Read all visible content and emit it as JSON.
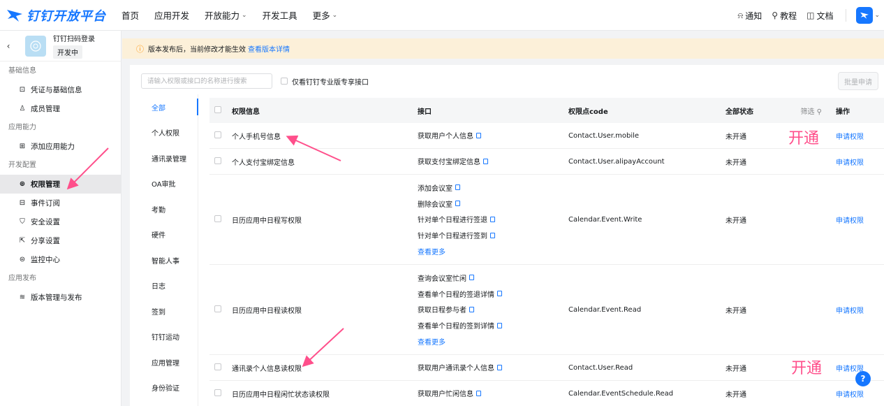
{
  "topbar": {
    "logo_text": "钉钉开放平台",
    "nav": [
      {
        "label": "首页",
        "dropdown": false
      },
      {
        "label": "应用开发",
        "dropdown": false
      },
      {
        "label": "开放能力",
        "dropdown": true
      },
      {
        "label": "开发工具",
        "dropdown": false
      },
      {
        "label": "更多",
        "dropdown": true
      }
    ],
    "notify": "通知",
    "tutorial": "教程",
    "docs": "文档"
  },
  "sidebar": {
    "app_name": "钉钉扫码登录",
    "app_status": "开发中",
    "groups": [
      {
        "label": "基础信息",
        "items": [
          {
            "label": "凭证与基础信息",
            "icon": "credential-icon",
            "glyph": "⊡"
          },
          {
            "label": "成员管理",
            "icon": "member-icon",
            "glyph": "♙"
          }
        ]
      },
      {
        "label": "应用能力",
        "items": [
          {
            "label": "添加应用能力",
            "icon": "add-capability-icon",
            "glyph": "⊞"
          }
        ]
      },
      {
        "label": "开发配置",
        "items": [
          {
            "label": "权限管理",
            "icon": "permission-icon",
            "glyph": "⊕",
            "active": true
          },
          {
            "label": "事件订阅",
            "icon": "event-icon",
            "glyph": "⊟"
          },
          {
            "label": "安全设置",
            "icon": "shield-icon",
            "glyph": "⛉"
          },
          {
            "label": "分享设置",
            "icon": "share-icon",
            "glyph": "⇱"
          },
          {
            "label": "监控中心",
            "icon": "monitor-icon",
            "glyph": "⊜"
          }
        ]
      },
      {
        "label": "应用发布",
        "items": [
          {
            "label": "版本管理与发布",
            "icon": "layers-icon",
            "glyph": "≋"
          }
        ]
      }
    ]
  },
  "notice": {
    "text": "版本发布后，当前修改才能生效",
    "link": "查看版本详情"
  },
  "filter": {
    "search_placeholder": "请输入权限或接口的名称进行搜索",
    "only_pro": "仅看钉钉专业版专享接口",
    "batch_apply": "批量申请"
  },
  "categories": [
    "全部",
    "个人权限",
    "通讯录管理",
    "OA审批",
    "考勤",
    "硬件",
    "智能人事",
    "日志",
    "签到",
    "钉钉运动",
    "应用管理",
    "身份验证"
  ],
  "table": {
    "headers": {
      "perm": "权限信息",
      "api": "接口",
      "code": "权限点code",
      "status": "全部状态",
      "filter": "筛选",
      "op": "操作"
    },
    "rows": [
      {
        "perm": "个人手机号信息",
        "apis": [
          "获取用户个人信息"
        ],
        "more": "",
        "code": "Contact.User.mobile",
        "status": "未开通",
        "op": "申请权限",
        "height": 37
      },
      {
        "perm": "个人支付宝绑定信息",
        "apis": [
          "获取支付宝绑定信息"
        ],
        "more": "",
        "code": "Contact.User.alipayAccount",
        "status": "未开通",
        "op": "申请权限",
        "height": 37
      },
      {
        "perm": "日历应用中日程写权限",
        "apis": [
          "添加会议室",
          "删除会议室",
          "针对单个日程进行签退",
          "针对单个日程进行签到"
        ],
        "more": "查看更多",
        "code": "Calendar.Event.Write",
        "status": "未开通",
        "op": "申请权限",
        "height": 129
      },
      {
        "perm": "日历应用中日程读权限",
        "apis": [
          "查询会议室忙闲",
          "查看单个日程的签退详情",
          "获取日程参与者",
          "查看单个日程的签到详情"
        ],
        "more": "查看更多",
        "code": "Calendar.Event.Read",
        "status": "未开通",
        "op": "申请权限",
        "height": 129
      },
      {
        "perm": "通讯录个人信息读权限",
        "apis": [
          "获取用户通讯录个人信息"
        ],
        "more": "",
        "code": "Contact.User.Read",
        "status": "未开通",
        "op": "申请权限",
        "height": 37
      },
      {
        "perm": "日历应用中日程闲忙状态读权限",
        "apis": [
          "获取用户忙闲信息"
        ],
        "more": "",
        "code": "Calendar.EventSchedule.Read",
        "status": "未开通",
        "op": "申请权限",
        "height": 37
      }
    ]
  },
  "annotations": {
    "open_1": "开通",
    "open_2": "开通"
  },
  "help": "?",
  "colors": {
    "primary": "#1677ff",
    "annotation": "#ff4f8b",
    "notice_bg": "#fcf0d9",
    "warn": "#ff9200"
  }
}
